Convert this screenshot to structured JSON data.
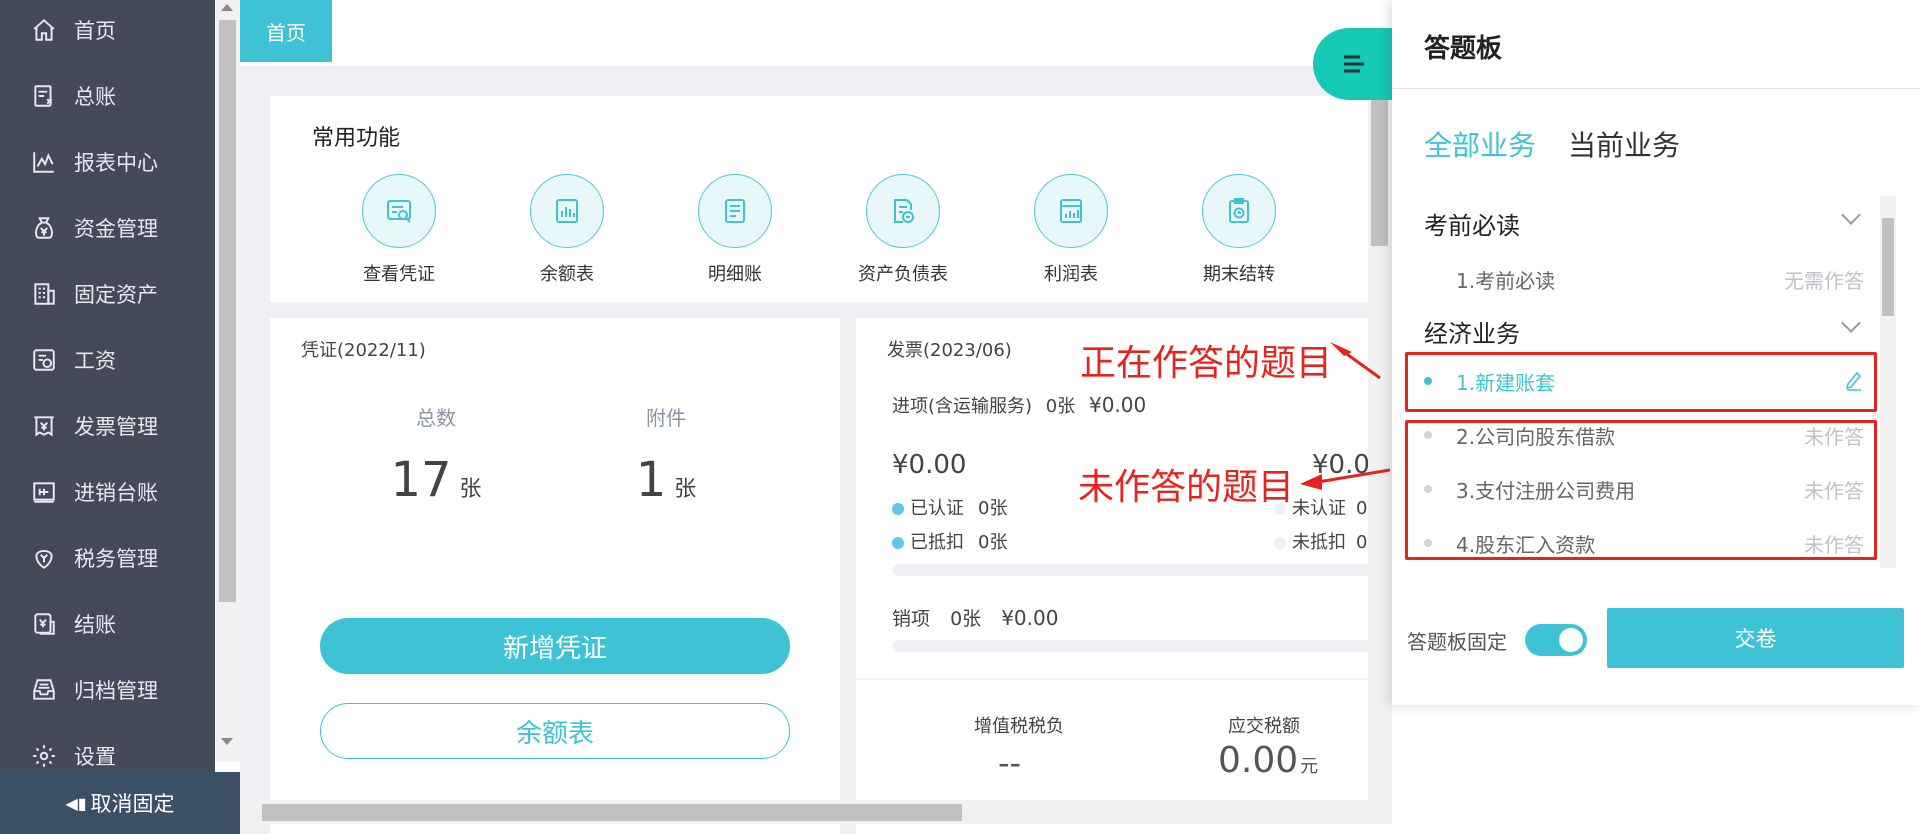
{
  "sidebar": {
    "items": [
      {
        "label": "首页",
        "icon": "home-icon"
      },
      {
        "label": "总账",
        "icon": "ledger-icon"
      },
      {
        "label": "报表中心",
        "icon": "report-chart-icon"
      },
      {
        "label": "资金管理",
        "icon": "money-bag-icon"
      },
      {
        "label": "固定资产",
        "icon": "building-icon"
      },
      {
        "label": "工资",
        "icon": "salary-icon"
      },
      {
        "label": "发票管理",
        "icon": "invoice-icon"
      },
      {
        "label": "进销台账",
        "icon": "account-book-icon"
      },
      {
        "label": "税务管理",
        "icon": "tax-icon"
      },
      {
        "label": "结账",
        "icon": "checkout-icon"
      },
      {
        "label": "归档管理",
        "icon": "archive-icon"
      },
      {
        "label": "设置",
        "icon": "gear-icon"
      }
    ],
    "unpin_label": "取消固定"
  },
  "tabs": {
    "home": "首页"
  },
  "quick": {
    "title": "常用功能",
    "items": [
      {
        "label": "查看凭证",
        "icon": "view-voucher-icon"
      },
      {
        "label": "余额表",
        "icon": "balance-sheet-icon"
      },
      {
        "label": "明细账",
        "icon": "detail-ledger-icon"
      },
      {
        "label": "资产负债表",
        "icon": "balance-statement-icon"
      },
      {
        "label": "利润表",
        "icon": "profit-statement-icon"
      },
      {
        "label": "期末结转",
        "icon": "period-end-icon"
      }
    ]
  },
  "voucher": {
    "title": "凭证(2022/11)",
    "total_label": "总数",
    "total_value": "17",
    "attach_label": "附件",
    "attach_value": "1",
    "unit": "张",
    "new_button": "新增凭证",
    "balance_button": "余额表"
  },
  "invoice": {
    "title": "发票(2023/06)",
    "input_label": "进项(含运输服务)",
    "input_count": "0张",
    "input_amount": "¥0.00",
    "left_amount": "¥0.00",
    "right_amount": "¥0.0",
    "certified": "已认证",
    "certified_count": "0张",
    "deducted": "已抵扣",
    "deducted_count": "0张",
    "uncertified": "未认证",
    "uncertified_count": "0",
    "undeducted": "未抵扣",
    "undeducted_count": "0",
    "output_label": "销项",
    "output_count": "0张",
    "output_amount": "¥0.00",
    "vat_label": "增值税税负",
    "vat_value": "--",
    "tax_label": "应交税额",
    "tax_value": "0.00",
    "tax_unit": "元",
    "dot_color": "#5bc8f0"
  },
  "annotations": {
    "answering": "正在作答的题目",
    "unanswered": "未作答的题目"
  },
  "panel": {
    "title": "答题板",
    "tab_all": "全部业务",
    "tab_current": "当前业务",
    "sections": [
      {
        "title": "考前必读",
        "items": [
          {
            "label": "1.考前必读",
            "status": "无需作答"
          }
        ]
      },
      {
        "title": "经济业务",
        "items": [
          {
            "label": "1.新建账套",
            "status": "editing"
          },
          {
            "label": "2.公司向股东借款",
            "status": "未作答"
          },
          {
            "label": "3.支付注册公司费用",
            "status": "未作答"
          },
          {
            "label": "4.股东汇入资款",
            "status": "未作答"
          }
        ]
      }
    ],
    "pin_label": "答题板固定",
    "pin_on": true,
    "submit": "交卷"
  },
  "colors": {
    "accent": "#3ec3d5",
    "toggle": "#16c8b6",
    "annotation": "#e8221d",
    "sidebar": "#454a5a"
  }
}
